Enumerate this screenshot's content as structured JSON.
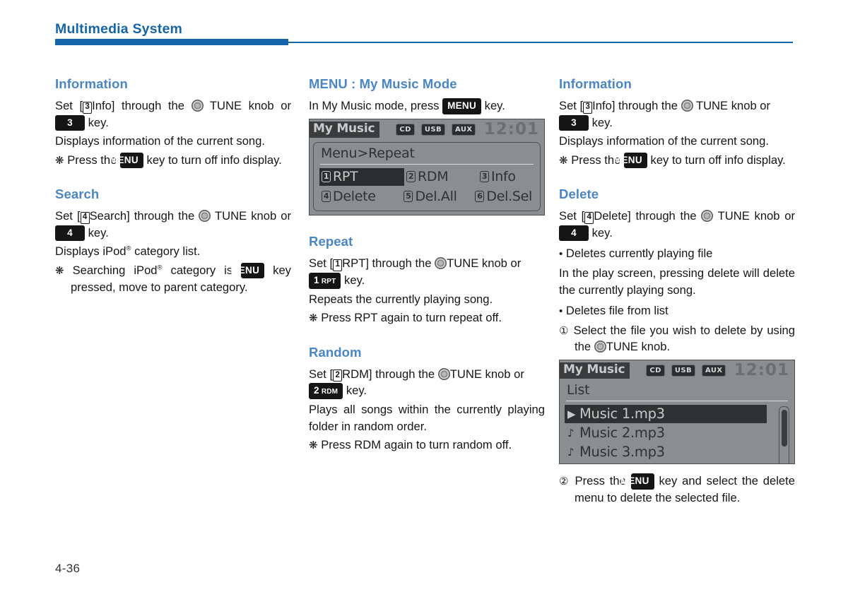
{
  "header": {
    "title": "Multimedia System",
    "accent_color": "#1565a8"
  },
  "heading_color": "#4a86c5",
  "footer": {
    "page_number": "4-36"
  },
  "icons": {
    "tune_knob": "tune-knob-icon",
    "note": "asterisk-note-symbol",
    "bullet": "bullet-symbol",
    "play_arrow": "play-arrow-icon",
    "music_note": "music-note-icon",
    "scroll_down_arrow": "chevron-down-icon"
  },
  "symbols": {
    "asterisk": "❋",
    "bullet": "•",
    "circled_1": "①",
    "circled_2": "②",
    "registered": "®",
    "play": "▶",
    "music_note": "♪"
  },
  "columns": {
    "left": {
      "information": {
        "heading": "Information",
        "line1_a": "Set [",
        "line1_num": "3",
        "line1_b": "Info] through the",
        "line1_c": "TUNE knob or",
        "key": "3",
        "line1_d": "key.",
        "line2": "Displays information of the current song.",
        "note_a": "Press the",
        "note_key": "MENU",
        "note_b": "key to turn off info display."
      },
      "search": {
        "heading": "Search",
        "line1_a": "Set [",
        "line1_num": "4",
        "line1_b": "Search] through the",
        "line1_c": "TUNE knob or",
        "key": "4",
        "line1_d": "key.",
        "line2_a": "Displays iPod",
        "line2_reg": "®",
        "line2_b": " category list.",
        "note_a": "Searching iPod",
        "note_reg": "®",
        "note_b": " category is",
        "note_key": "MENU",
        "note_c": "key pressed, move to parent category."
      }
    },
    "middle": {
      "menu_mode": {
        "heading": "MENU : My Music Mode",
        "line1_a": "In My Music mode, press",
        "line1_key": "MENU",
        "line1_b": "key."
      },
      "lcd_menu": {
        "mode_label": "My Music",
        "sources": [
          "CD",
          "USB",
          "AUX"
        ],
        "clock": "12:01",
        "breadcrumb": "Menu>Repeat",
        "items": [
          {
            "num": "1",
            "label": "RPT",
            "selected": true
          },
          {
            "num": "2",
            "label": "RDM",
            "selected": false
          },
          {
            "num": "3",
            "label": "Info",
            "selected": false
          },
          {
            "num": "4",
            "label": "Delete",
            "selected": false
          },
          {
            "num": "5",
            "label": "Del.All",
            "selected": false
          },
          {
            "num": "6",
            "label": "Del.Sel",
            "selected": false
          }
        ]
      },
      "repeat": {
        "heading": "Repeat",
        "line1_a": "Set [",
        "line1_num": "1",
        "line1_b": "RPT] through the",
        "line1_c": "TUNE knob or",
        "key_num": "1",
        "key_sub": "RPT",
        "line1_d": "key.",
        "line2": "Repeats the currently playing song.",
        "note": "Press RPT again to turn repeat off."
      },
      "random": {
        "heading": "Random",
        "line1_a": "Set [",
        "line1_num": "2",
        "line1_b": "RDM] through the",
        "line1_c": "TUNE knob or",
        "key_num": "2",
        "key_sub": "RDM",
        "line1_d": "key.",
        "line2": "Plays all songs within the currently playing folder in random order.",
        "note": "Press RDM again to turn random off."
      }
    },
    "right": {
      "information": {
        "heading": "Information",
        "line1_a": "Set [",
        "line1_num": "3",
        "line1_b": "Info] through the",
        "line1_c": "TUNE knob or",
        "key": "3",
        "line1_d": "key.",
        "line2": "Displays information of the current song.",
        "note_a": "Press the",
        "note_key": "MENU",
        "note_b": "key to turn off info display."
      },
      "delete": {
        "heading": "Delete",
        "line1_a": "Set [",
        "line1_num": "4",
        "line1_b": "Delete] through the",
        "line1_c": "TUNE knob or",
        "key": "4",
        "line1_d": "key.",
        "bullet1": "Deletes currently playing file",
        "para1": "In the play screen, pressing delete will delete the currently playing song.",
        "bullet2": "Deletes file from list",
        "step1_a": "Select the file you wish to delete by using the",
        "step1_b": "TUNE knob.",
        "step2_a": "Press the",
        "step2_key": "MENU",
        "step2_b": "key and select the delete menu to delete the selected file."
      },
      "lcd_list": {
        "mode_label": "My Music",
        "sources": [
          "CD",
          "USB",
          "AUX"
        ],
        "clock": "12:01",
        "breadcrumb": "List",
        "rows": [
          {
            "icon": "▶",
            "label": "Music 1.mp3",
            "selected": true
          },
          {
            "icon": "♪",
            "label": "Music 2.mp3",
            "selected": false
          },
          {
            "icon": "♪",
            "label": "Music 3.mp3",
            "selected": false
          }
        ]
      }
    }
  }
}
